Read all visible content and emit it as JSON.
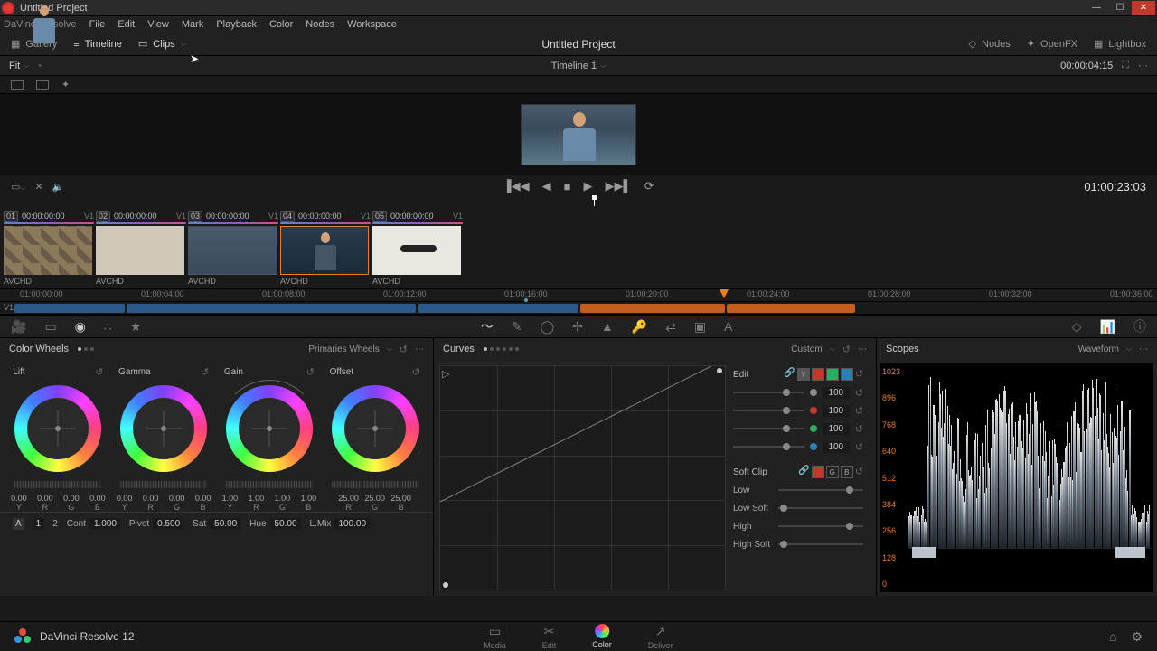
{
  "titlebar": {
    "title": "Untitled Project"
  },
  "menu": {
    "app": "DaVinci Resolve",
    "items": [
      "File",
      "Edit",
      "View",
      "Mark",
      "Playback",
      "Color",
      "Nodes",
      "Workspace"
    ]
  },
  "toolbar": {
    "left": [
      {
        "label": "Gallery",
        "icon": "grid"
      },
      {
        "label": "Timeline",
        "icon": "timeline"
      },
      {
        "label": "Clips",
        "icon": "clips"
      }
    ],
    "project": "Untitled Project",
    "right": [
      {
        "label": "Nodes",
        "icon": "nodes"
      },
      {
        "label": "OpenFX",
        "icon": "fx"
      },
      {
        "label": "Lightbox",
        "icon": "grid"
      }
    ]
  },
  "fitrow": {
    "fit": "Fit",
    "timeline": "Timeline 1",
    "timecode": "00:00:04:15"
  },
  "transport": {
    "timecode": "01:00:23:03"
  },
  "clips": [
    {
      "num": "01",
      "tc": "00:00:00:00",
      "track": "V1",
      "label": "AVCHD"
    },
    {
      "num": "02",
      "tc": "00:00:00:00",
      "track": "V1",
      "label": "AVCHD"
    },
    {
      "num": "03",
      "tc": "00:00:00:00",
      "track": "V1",
      "label": "AVCHD"
    },
    {
      "num": "04",
      "tc": "00:00:00:00",
      "track": "V1",
      "label": "AVCHD",
      "selected": true
    },
    {
      "num": "05",
      "tc": "00:00:00:00",
      "track": "V1",
      "label": "AVCHD"
    }
  ],
  "ruler": [
    "01:00:00:00",
    "01:00:04:00",
    "01:00:08:00",
    "01:00:12:00",
    "01:00:16:00",
    "01:00:20:00",
    "01:00:24:00",
    "01:00:28:00",
    "01:00:32:00",
    "01:00:36:00"
  ],
  "track": {
    "label": "V1"
  },
  "wheels": {
    "title": "Color Wheels",
    "mode": "Primaries Wheels",
    "cols": [
      {
        "name": "Lift",
        "vals": [
          "0.00",
          "0.00",
          "0.00",
          "0.00"
        ],
        "labels": [
          "Y",
          "R",
          "G",
          "B"
        ]
      },
      {
        "name": "Gamma",
        "vals": [
          "0.00",
          "0.00",
          "0.00",
          "0.00"
        ],
        "labels": [
          "Y",
          "R",
          "G",
          "B"
        ]
      },
      {
        "name": "Gain",
        "vals": [
          "1.00",
          "1.00",
          "1.00",
          "1.00"
        ],
        "labels": [
          "Y",
          "R",
          "G",
          "B"
        ]
      },
      {
        "name": "Offset",
        "vals": [
          "25.00",
          "25.00",
          "25.00"
        ],
        "labels": [
          "R",
          "G",
          "B"
        ]
      }
    ],
    "footer": {
      "a": "A",
      "n1": "1",
      "n2": "2",
      "cont": "Cont",
      "cont_v": "1.000",
      "pivot": "Pivot",
      "pivot_v": "0.500",
      "sat": "Sat",
      "sat_v": "50.00",
      "hue": "Hue",
      "hue_v": "50.00",
      "lmix": "L.Mix",
      "lmix_v": "100.00"
    }
  },
  "curves": {
    "title": "Curves",
    "mode": "Custom",
    "edit": "Edit",
    "channels": [
      "Y",
      "R",
      "G",
      "B"
    ],
    "rows": [
      {
        "color": "#888",
        "val": "100"
      },
      {
        "color": "#c0392b",
        "val": "100"
      },
      {
        "color": "#27ae60",
        "val": "100"
      },
      {
        "color": "#2980b9",
        "val": "100"
      }
    ],
    "softclip": "Soft Clip",
    "soft": [
      {
        "label": "Low"
      },
      {
        "label": "Low Soft"
      },
      {
        "label": "High"
      },
      {
        "label": "High Soft"
      }
    ]
  },
  "scopes": {
    "title": "Scopes",
    "mode": "Waveform",
    "axis": [
      "1023",
      "896",
      "768",
      "640",
      "512",
      "384",
      "256",
      "128",
      "0"
    ]
  },
  "bottom": {
    "title": "DaVinci Resolve 12",
    "pages": [
      "Media",
      "Edit",
      "Color",
      "Deliver"
    ]
  }
}
